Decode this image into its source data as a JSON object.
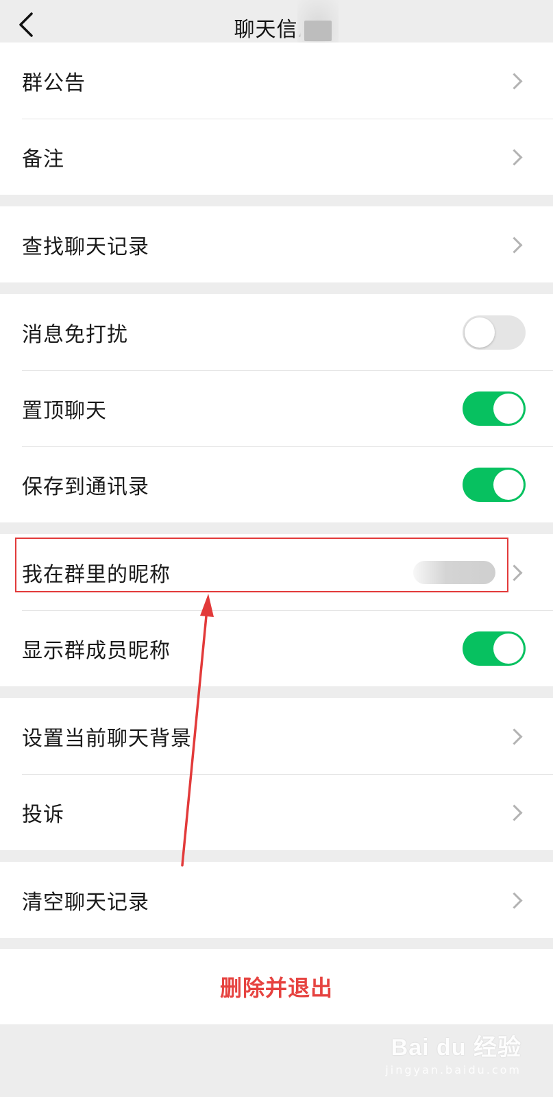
{
  "header": {
    "title": "聊天信息"
  },
  "groups": [
    {
      "items": [
        {
          "label": "群公告",
          "control": "chevron"
        },
        {
          "label": "备注",
          "control": "chevron"
        }
      ]
    },
    {
      "items": [
        {
          "label": "查找聊天记录",
          "control": "chevron"
        }
      ]
    },
    {
      "items": [
        {
          "label": "消息免打扰",
          "control": "toggle",
          "on": false
        },
        {
          "label": "置顶聊天",
          "control": "toggle",
          "on": true
        },
        {
          "label": "保存到通讯录",
          "control": "toggle",
          "on": true
        }
      ]
    },
    {
      "items": [
        {
          "label": "我在群里的昵称",
          "control": "chevron"
        },
        {
          "label": "显示群成员昵称",
          "control": "toggle",
          "on": true
        }
      ]
    },
    {
      "items": [
        {
          "label": "设置当前聊天背景",
          "control": "chevron"
        },
        {
          "label": "投诉",
          "control": "chevron"
        }
      ]
    },
    {
      "items": [
        {
          "label": "清空聊天记录",
          "control": "chevron"
        }
      ]
    }
  ],
  "delete": {
    "label": "删除并退出"
  },
  "colors": {
    "toggle_on": "#07c160",
    "toggle_off": "#e5e5e5",
    "delete_text": "#e64340",
    "annotation": "#e23a3a",
    "background": "#ededed"
  },
  "watermark": {
    "main": "Bai du 经验",
    "sub": "jingyan.baidu.com"
  }
}
